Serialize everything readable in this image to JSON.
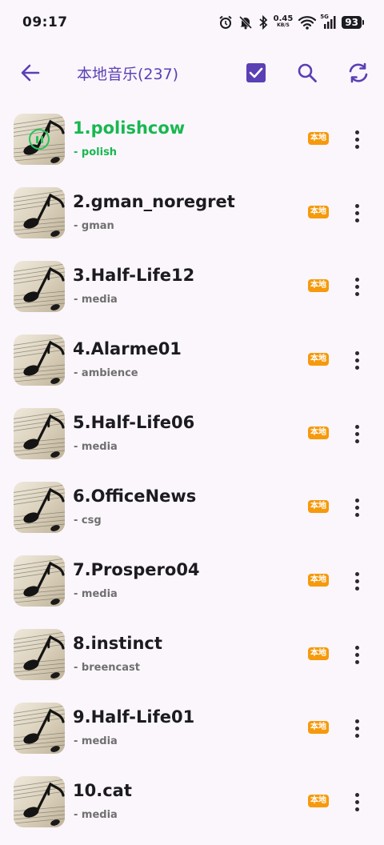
{
  "status_bar": {
    "time": "09:17",
    "net_speed_value": "0.45",
    "net_speed_unit": "KB/S",
    "network_type": "5G",
    "battery": "93",
    "icons": [
      "alarm-icon",
      "mute-icon",
      "bluetooth-icon",
      "wifi-icon",
      "signal-icon",
      "battery-icon"
    ]
  },
  "toolbar": {
    "title": "本地音乐(237)",
    "icons": [
      "back-arrow-icon",
      "checkbox-icon",
      "search-icon",
      "sync-icon"
    ],
    "accent_color": "#5b3fb4"
  },
  "songs": [
    {
      "title": "1.polishcow",
      "artist": "- polish",
      "badge": "本地",
      "playing": true
    },
    {
      "title": "2.gman_noregret",
      "artist": "- gman",
      "badge": "本地",
      "playing": false
    },
    {
      "title": "3.Half-Life12",
      "artist": "- media",
      "badge": "本地",
      "playing": false
    },
    {
      "title": "4.Alarme01",
      "artist": "- ambience",
      "badge": "本地",
      "playing": false
    },
    {
      "title": "5.Half-Life06",
      "artist": "- media",
      "badge": "本地",
      "playing": false
    },
    {
      "title": "6.OfficeNews",
      "artist": "- csg",
      "badge": "本地",
      "playing": false
    },
    {
      "title": "7.Prospero04",
      "artist": "- media",
      "badge": "本地",
      "playing": false
    },
    {
      "title": "8.instinct",
      "artist": "- breencast",
      "badge": "本地",
      "playing": false
    },
    {
      "title": "9.Half-Life01",
      "artist": "- media",
      "badge": "本地",
      "playing": false
    },
    {
      "title": "10.cat",
      "artist": "- media",
      "badge": "本地",
      "playing": false
    }
  ],
  "colors": {
    "playing": "#18b850",
    "badge": "#f59a0c",
    "background": "#fbf6fc"
  }
}
